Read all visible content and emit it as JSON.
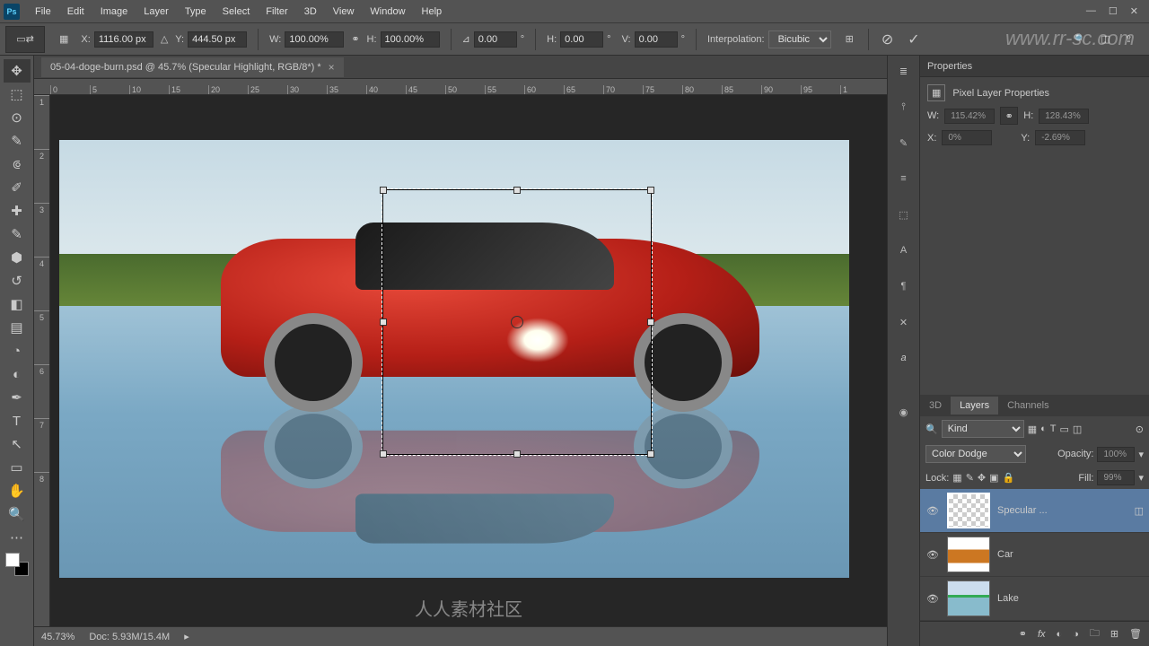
{
  "menu": [
    "File",
    "Edit",
    "Image",
    "Layer",
    "Type",
    "Select",
    "Filter",
    "3D",
    "View",
    "Window",
    "Help"
  ],
  "options": {
    "x_label": "X:",
    "x": "1116.00 px",
    "y_label": "Y:",
    "y": "444.50 px",
    "w_label": "W:",
    "w": "100.00%",
    "h_label": "H:",
    "h": "100.00%",
    "angle_label": "⊿",
    "angle": "0.00",
    "skew_h_label": "H:",
    "skew_h": "0.00",
    "skew_v_label": "V:",
    "skew_v": "0.00",
    "interp_label": "Interpolation:",
    "interp": "Bicubic"
  },
  "tab": {
    "title": "05-04-doge-burn.psd @ 45.7% (Specular Highlight, RGB/8*) *"
  },
  "ruler_h": [
    "0",
    "5",
    "10",
    "15",
    "20",
    "25",
    "30",
    "35",
    "40",
    "45",
    "50",
    "55",
    "60",
    "65",
    "70",
    "75",
    "80",
    "85",
    "90",
    "95",
    "1"
  ],
  "ruler_v": [
    "1",
    "2",
    "3",
    "4",
    "5",
    "6",
    "7",
    "8"
  ],
  "status": {
    "zoom": "45.73%",
    "doc": "Doc: 5.93M/15.4M"
  },
  "prop": {
    "panel_title": "Properties",
    "section": "Pixel Layer Properties",
    "w_label": "W:",
    "w": "115.42%",
    "h_label": "H:",
    "h": "128.43%",
    "x_label": "X:",
    "x": "0%",
    "y_label": "Y:",
    "y": "-2.69%"
  },
  "ltabs": {
    "a": "3D",
    "b": "Layers",
    "c": "Channels"
  },
  "layers_filter": {
    "kind_icon": "🔍",
    "kind": "Kind"
  },
  "layers_blend": {
    "mode": "Color Dodge",
    "opacity_label": "Opacity:",
    "opacity": "100%"
  },
  "layers_lock": {
    "label": "Lock:",
    "fill_label": "Fill:",
    "fill": "99%"
  },
  "layers": [
    {
      "name": "Specular ..."
    },
    {
      "name": "Car"
    },
    {
      "name": "Lake"
    }
  ],
  "watermark": "www.rr-sc.com",
  "sc_mark": "人人素材社区"
}
